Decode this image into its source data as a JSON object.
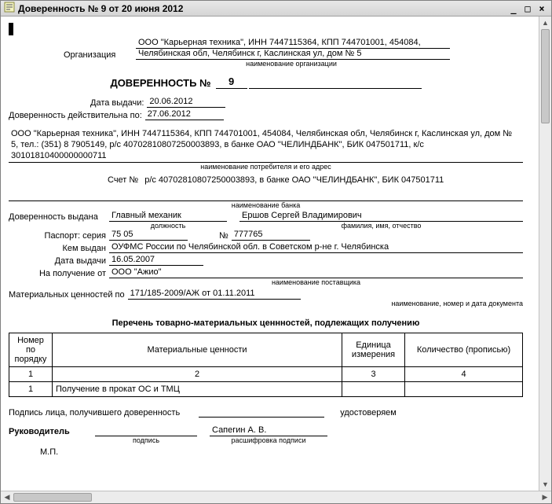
{
  "window": {
    "title": "Доверенность № 9 от 20 июня 2012"
  },
  "organization": {
    "label": "Организация",
    "line1": "ООО \"Карьерная техника\", ИНН 7447115364, КПП 744701001, 454084,",
    "line2": "Челябинская обл, Челябинск г, Каслинская ул, дом № 5",
    "caption": "наименование организации"
  },
  "doc": {
    "title": "ДОВЕРЕННОСТЬ №",
    "number": "9",
    "issue_date_label": "Дата выдачи:",
    "issue_date": "20.06.2012",
    "valid_until_label": "Доверенность действительна по:",
    "valid_until": "27.06.2012"
  },
  "consumer": {
    "text": "ООО \"Карьерная техника\", ИНН 7447115364, КПП 744701001, 454084, Челябинская обл, Челябинск г, Каслинская ул, дом № 5, тел.: (351) 8  7905149, р/с 40702810807250003893, в банке ОАО \"ЧЕЛИНДБАНК\", БИК 047501711, к/с 30101810400000000711",
    "caption": "наименование потребителя и его адрес"
  },
  "account": {
    "label": "Счет №",
    "value": "р/с 40702810807250003893, в банке ОАО \"ЧЕЛИНДБАНК\", БИК 047501711",
    "caption": "наименование банка"
  },
  "issued_to": {
    "label": "Доверенность выдана",
    "position": "Главный механик",
    "position_caption": "должность",
    "fio": "Ершов Сергей Владимирович",
    "fio_caption": "фамилия, имя, отчество"
  },
  "passport": {
    "label": "Паспорт: серия",
    "series": "75 05",
    "num_label": "№",
    "number": "777765",
    "issued_by_label": "Кем выдан",
    "issued_by": "ОУФМС России по Челябинской обл. в Советском р-не г. Челябинска",
    "issue_date_label": "Дата выдачи",
    "issue_date": "16.05.2007"
  },
  "received_from": {
    "label": "На получение от",
    "value": "ООО \"Ажио\"",
    "caption": "наименование поставщика"
  },
  "basis": {
    "label": "Материальных ценностей по",
    "value": "171/185-2009/АЖ от 01.11.2011",
    "caption": "наименование, номер и дата документа"
  },
  "table": {
    "title": "Перечень товарно-материальных ценнностей, подлежащих получению",
    "headers": {
      "num": "Номер по порядку",
      "name": "Материальные ценности",
      "unit": "Единица измерения",
      "qty": "Количество (прописью)"
    },
    "colnums": {
      "c1": "1",
      "c2": "2",
      "c3": "3",
      "c4": "4"
    },
    "rows": [
      {
        "num": "1",
        "name": "Получение в прокат ОС и ТМЦ",
        "unit": "",
        "qty": ""
      }
    ]
  },
  "footer": {
    "sig_receiver_label": "Подпись лица, получившего доверенность",
    "certify": "удостоверяем",
    "head_label": "Руководитель",
    "sig_caption": "подпись",
    "head_name": "Сапегин А. В.",
    "decode_caption": "расшифровка подписи",
    "stamp": "М.П."
  }
}
